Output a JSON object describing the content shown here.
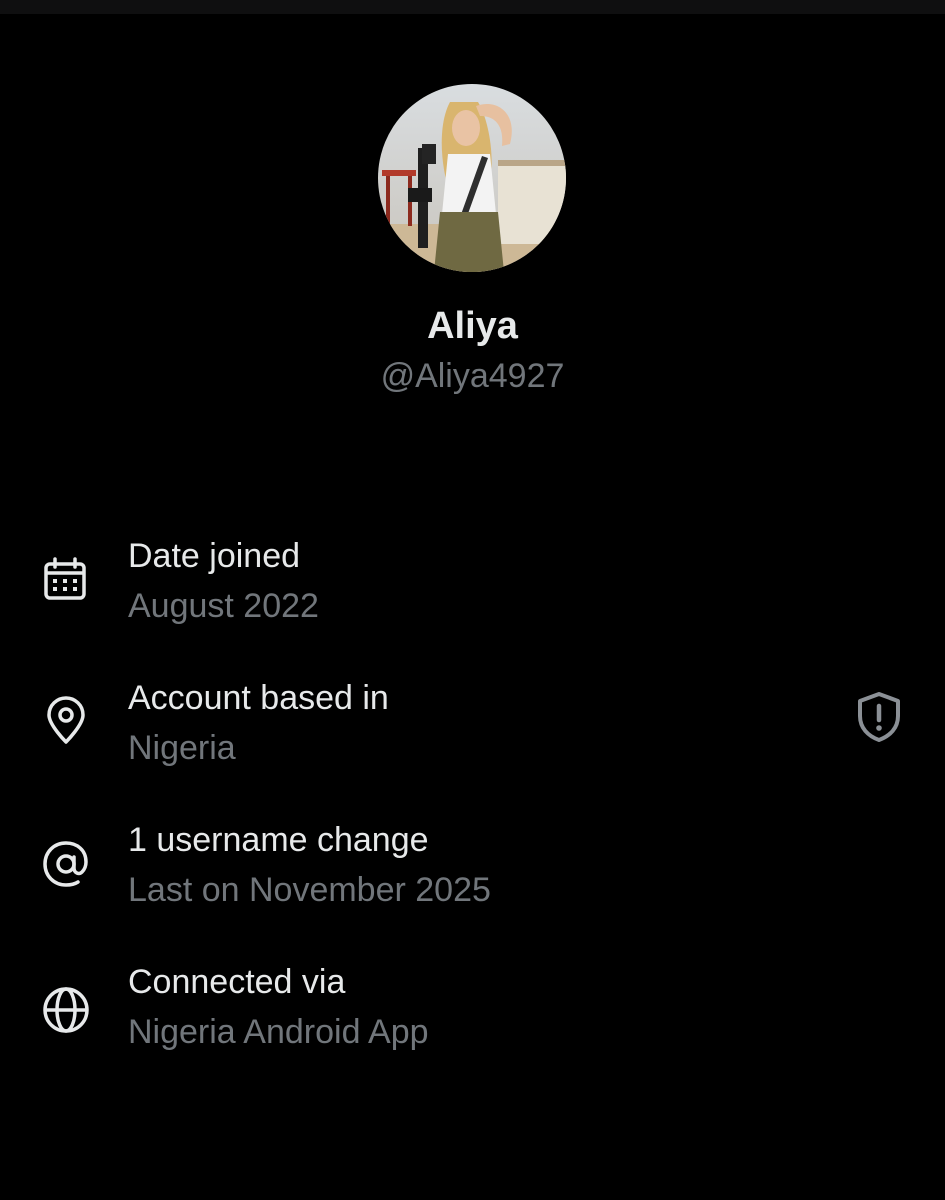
{
  "profile": {
    "display_name": "Aliya",
    "handle": "@Aliya4927",
    "avatar_icon": "profile-photo"
  },
  "about": {
    "rows": [
      {
        "icon": "calendar-icon",
        "label": "Date joined",
        "value": "August 2022"
      },
      {
        "icon": "location-pin-icon",
        "label": "Account based in",
        "value": "Nigeria",
        "trailing_icon": "shield-alert-icon"
      },
      {
        "icon": "at-sign-icon",
        "label": "1 username change",
        "value": "Last on November 2025"
      },
      {
        "icon": "globe-icon",
        "label": "Connected via",
        "value": "Nigeria Android App"
      }
    ]
  },
  "colors": {
    "background": "#000000",
    "primary_text": "#e7e9ea",
    "secondary_text": "#71767b"
  }
}
